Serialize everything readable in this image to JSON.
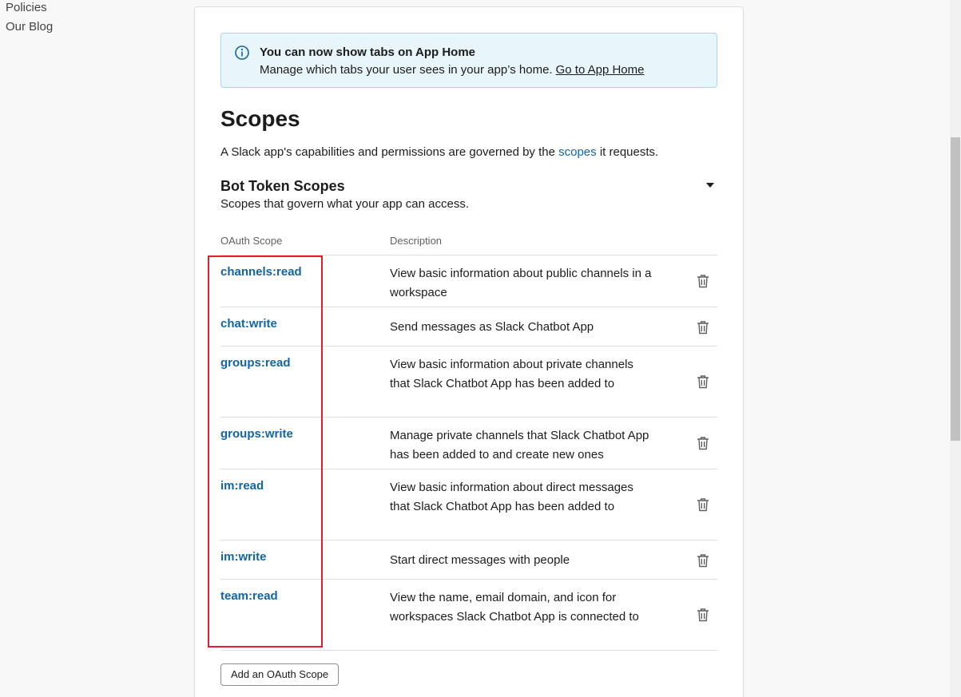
{
  "sidebar": {
    "links": [
      "Policies",
      "Our Blog"
    ]
  },
  "banner": {
    "title": "You can now show tabs on App Home",
    "body": "Manage which tabs your user sees in your app’s home.",
    "link": "Go to App Home"
  },
  "page": {
    "title": "Scopes",
    "intro_before": "A Slack app's capabilities and permissions are governed by the",
    "intro_link": "scopes",
    "intro_after": "it requests."
  },
  "section": {
    "title": "Bot Token Scopes",
    "subtitle": "Scopes that govern what your app can access."
  },
  "table": {
    "headers": [
      "OAuth Scope",
      "Description"
    ],
    "rows": [
      {
        "scope": "channels:read",
        "description": "View basic information about public channels in a workspace"
      },
      {
        "scope": "chat:write",
        "description": "Send messages as Slack Chatbot App"
      },
      {
        "scope": "groups:read",
        "description": "View basic information about private channels that Slack Chatbot App has been added to"
      },
      {
        "scope": "groups:write",
        "description": "Manage private channels that Slack Chatbot App has been added to and create new ones"
      },
      {
        "scope": "im:read",
        "description": "View basic information about direct messages that Slack Chatbot App has been added to"
      },
      {
        "scope": "im:write",
        "description": "Start direct messages with people"
      },
      {
        "scope": "team:read",
        "description": "View the name, email domain, and icon for workspaces Slack Chatbot App is connected to"
      }
    ]
  },
  "actions": {
    "add_scope": "Add an OAuth Scope"
  },
  "icons": {
    "info": "info-icon",
    "caret": "caret-down-icon",
    "trash": "trash-icon"
  },
  "colors": {
    "link": "#1264a3",
    "banner_bg": "#e8f5fa",
    "highlight": "#e01e2f"
  }
}
